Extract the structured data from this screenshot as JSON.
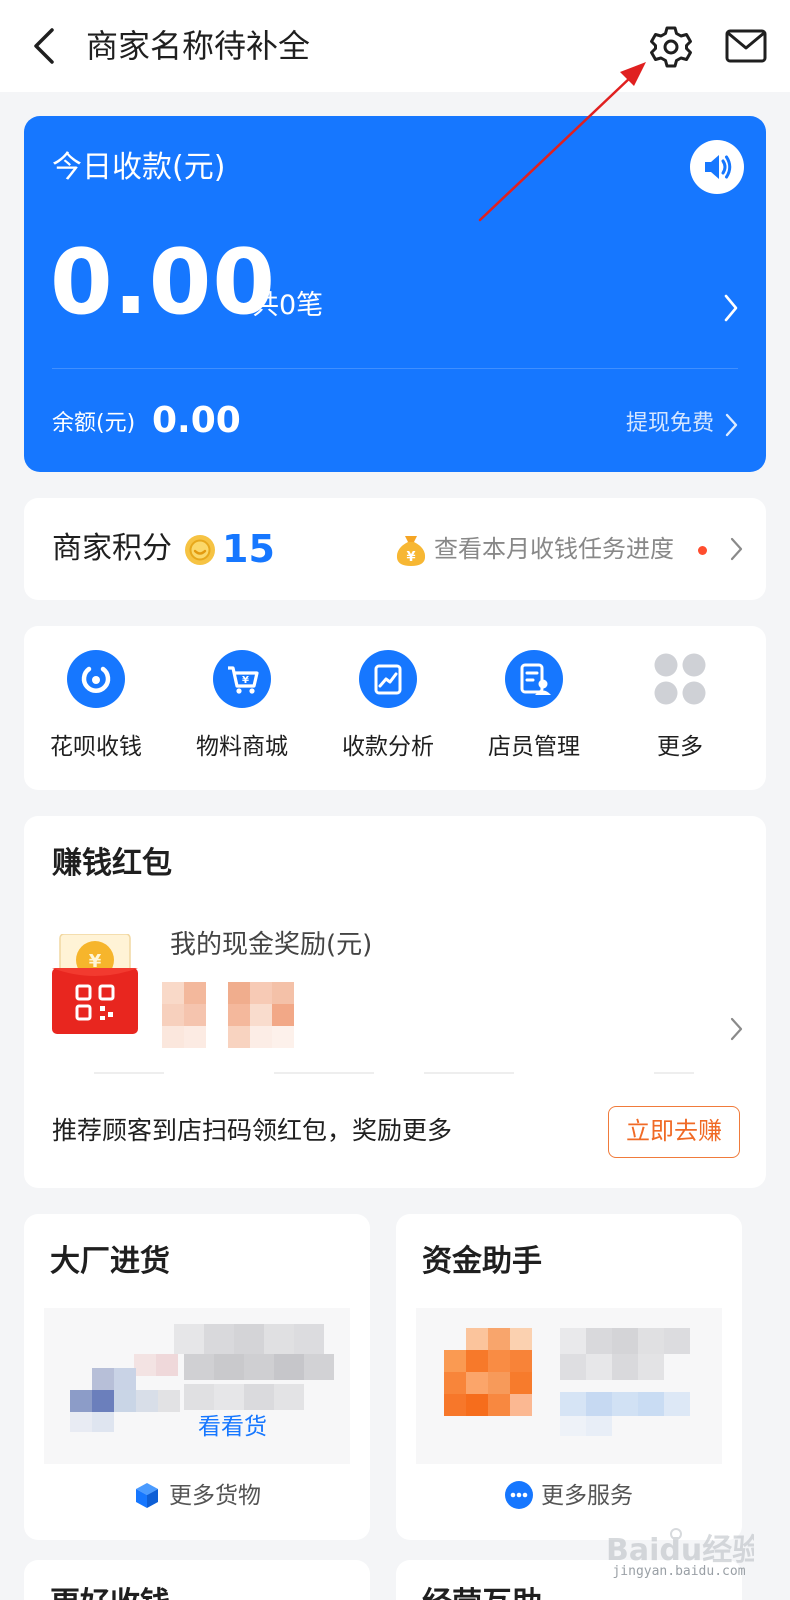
{
  "header": {
    "title": "商家名称待补全",
    "icons": [
      "chevron-left-icon",
      "gear-icon",
      "mail-icon"
    ]
  },
  "today_card": {
    "title": "今日收款(元)",
    "amount": "0.00",
    "count": "共0笔",
    "balance_label": "余额(元)",
    "balance_value": "0.00",
    "withdraw_label": "提现免费",
    "accent": "#1677ff"
  },
  "points": {
    "label": "商家积分",
    "value": "15",
    "task_link": "查看本月收钱任务进度",
    "value_color": "#1677ff",
    "dot_color": "#ff4d2e"
  },
  "actions": [
    {
      "label": "花呗收钱",
      "icon": "huabei-icon"
    },
    {
      "label": "物料商城",
      "icon": "shopping-cart-icon"
    },
    {
      "label": "收款分析",
      "icon": "trend-chart-icon"
    },
    {
      "label": "店员管理",
      "icon": "staff-document-icon"
    },
    {
      "label": "更多",
      "icon": "grid-more-icon"
    }
  ],
  "red_packet": {
    "title": "赚钱红包",
    "reward_label": "我的现金奖励(元)",
    "description": "推荐顾客到店扫码领红包，奖励更多",
    "button": "立即去赚",
    "button_color": "#f06a26"
  },
  "wholesale": {
    "title": "大厂进货",
    "see_goods": "看看货",
    "footer": "更多货物"
  },
  "finance": {
    "title": "资金助手",
    "footer": "更多服务"
  },
  "bottom_peek": {
    "left_title": "更好收钱",
    "right_title": "经营互助"
  },
  "watermark": {
    "brand": "Baidu经验",
    "url": "jingyan.baidu.com"
  }
}
